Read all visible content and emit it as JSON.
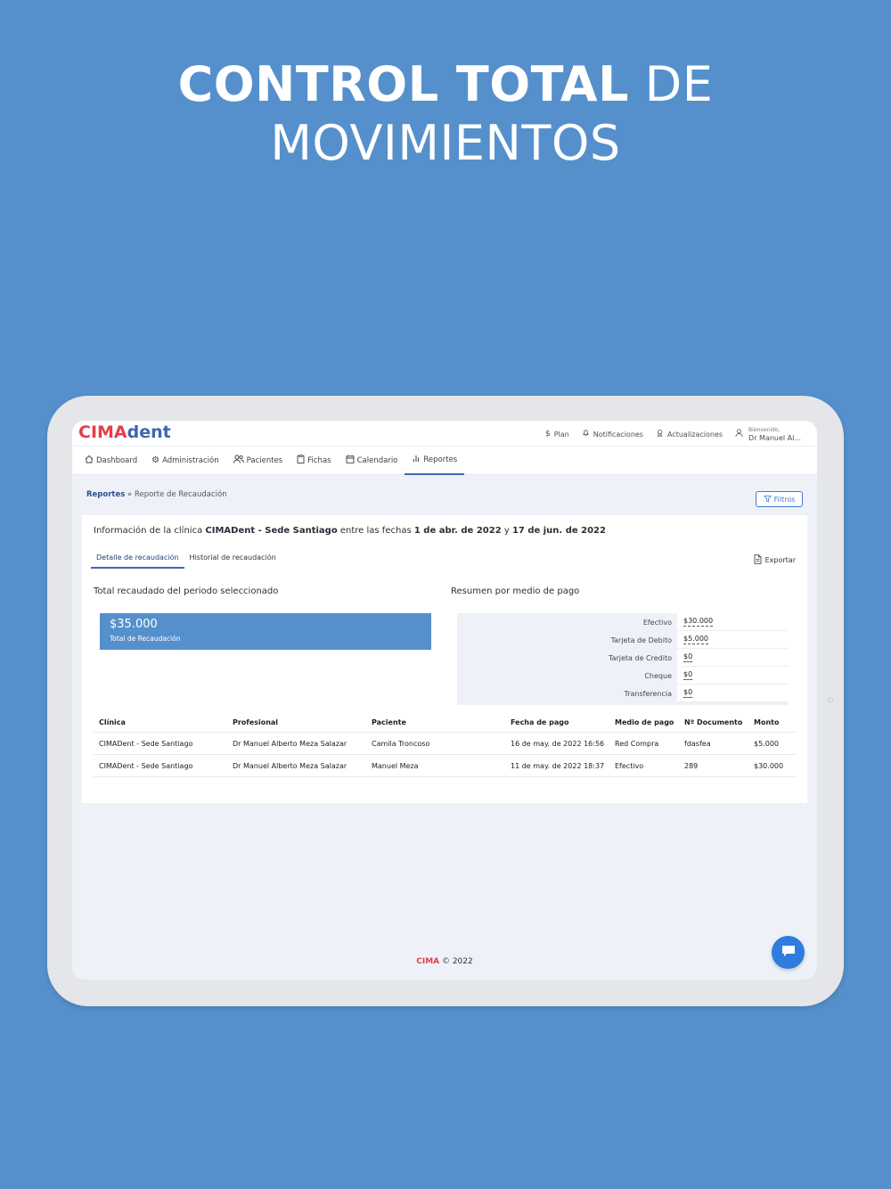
{
  "headline": {
    "bold": "CONTROL TOTAL",
    "light": " DE",
    "line2": "MOVIMIENTOS"
  },
  "app": {
    "logo_red": "CIM",
    "logo_mid": "A",
    "logo_blue": "dent"
  },
  "topnav": {
    "plan": "Plan",
    "notifications": "Notificaciones",
    "updates": "Actualizaciones",
    "welcome": "Bienvenido,",
    "user": "Dr Manuel Al..."
  },
  "mainnav": {
    "dashboard": "Dashboard",
    "admin": "Administración",
    "patients": "Pacientes",
    "records": "Fichas",
    "calendar": "Calendario",
    "reports": "Reportes"
  },
  "breadcrumb": {
    "root": "Reportes",
    "current": "Reporte de Recaudación"
  },
  "filters_label": "Filtros",
  "info": {
    "prefix": "Información de la clínica ",
    "clinic": "CIMADent - Sede Santiago",
    "mid": " entre las fechas ",
    "from": "1 de abr. de 2022",
    "and": " y ",
    "to": "17 de jun. de 2022"
  },
  "subtabs": {
    "detail": "Detalle de recaudación",
    "history": "Historial de recaudación"
  },
  "export_label": "Exportar",
  "sections": {
    "total_title": "Total recaudado del periodo seleccionado",
    "summary_title": "Resumen por medio de pago"
  },
  "total": {
    "amount": "$35.000",
    "label": "Total de Recaudación"
  },
  "summary": [
    {
      "method": "Efectivo",
      "amount": "$30.000"
    },
    {
      "method": "Tarjeta de Debito",
      "amount": "$5.000"
    },
    {
      "method": "Tarjeta de Credito",
      "amount": "$0"
    },
    {
      "method": "Cheque",
      "amount": "$0"
    },
    {
      "method": "Transferencia",
      "amount": "$0"
    }
  ],
  "table": {
    "headers": [
      "Clínica",
      "Profesional",
      "Paciente",
      "Fecha de pago",
      "Medio de pago",
      "Nº Documento",
      "Monto"
    ],
    "rows": [
      [
        "CIMADent - Sede Santiago",
        "Dr Manuel Alberto Meza Salazar",
        "Camila Troncoso",
        "16 de may. de 2022 16:56",
        "Red Compra",
        "fdasfea",
        "$5.000"
      ],
      [
        "CIMADent - Sede Santiago",
        "Dr Manuel Alberto Meza Salazar",
        "Manuel Meza",
        "11 de may. de 2022 18:37",
        "Efectivo",
        "289",
        "$30.000"
      ]
    ]
  },
  "footer": {
    "brand": "CIMA",
    "text": " © 2022"
  },
  "colors": {
    "background": "#5590cc",
    "accent": "#3f66b3",
    "brand_red": "#e43d4c",
    "chat": "#2f7be0"
  }
}
